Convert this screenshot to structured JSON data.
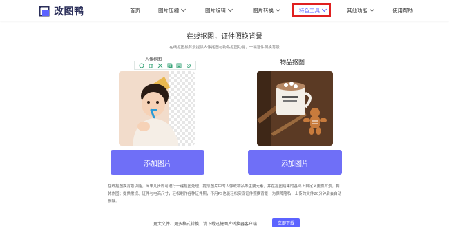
{
  "brand": {
    "name": "改图鸭"
  },
  "nav": {
    "items": [
      {
        "label": "首页",
        "has_dropdown": false,
        "active": false
      },
      {
        "label": "图片压缩",
        "has_dropdown": true,
        "active": false
      },
      {
        "label": "图片编辑",
        "has_dropdown": true,
        "active": false
      },
      {
        "label": "图片转换",
        "has_dropdown": true,
        "active": false
      },
      {
        "label": "特色工具",
        "has_dropdown": true,
        "active": true
      },
      {
        "label": "其他功能",
        "has_dropdown": true,
        "active": false
      },
      {
        "label": "使用帮助",
        "has_dropdown": false,
        "active": false
      }
    ]
  },
  "main": {
    "title": "在线抠图，证件照换背景",
    "subtitle": "在线抠图换背景提供人像抠图与物品抠图功能，一键证件照换背景",
    "portrait": {
      "label": "人像抠图",
      "button": "添加图片"
    },
    "object": {
      "label": "物品抠图",
      "button": "添加图片"
    },
    "toolbar_icons": [
      "layers-icon",
      "trash-icon",
      "crop-icon",
      "copy-icon",
      "download-icon",
      "settings-icon"
    ],
    "description": "在线抠图换背景功能，简单几步即可进行一键抠图处理，提取图片中的人像或物品等主要元素，并在抠图结果的基础上自定义更换背景，赛休作图；提供常规、证件与电商尺寸，轻松制作各种证件照，不用PS也能轻松实现证件照换背景，为保障隐私，上传的文件20分钟后会自动删除。"
  },
  "footer": {
    "text": "更大文件、更多格式转换，请下载迅捷图片转换器客户端",
    "button": "立即下载"
  },
  "colors": {
    "accent": "#6f6ff7",
    "nav_active": "#5c63ff",
    "highlight_box": "#e02020"
  }
}
